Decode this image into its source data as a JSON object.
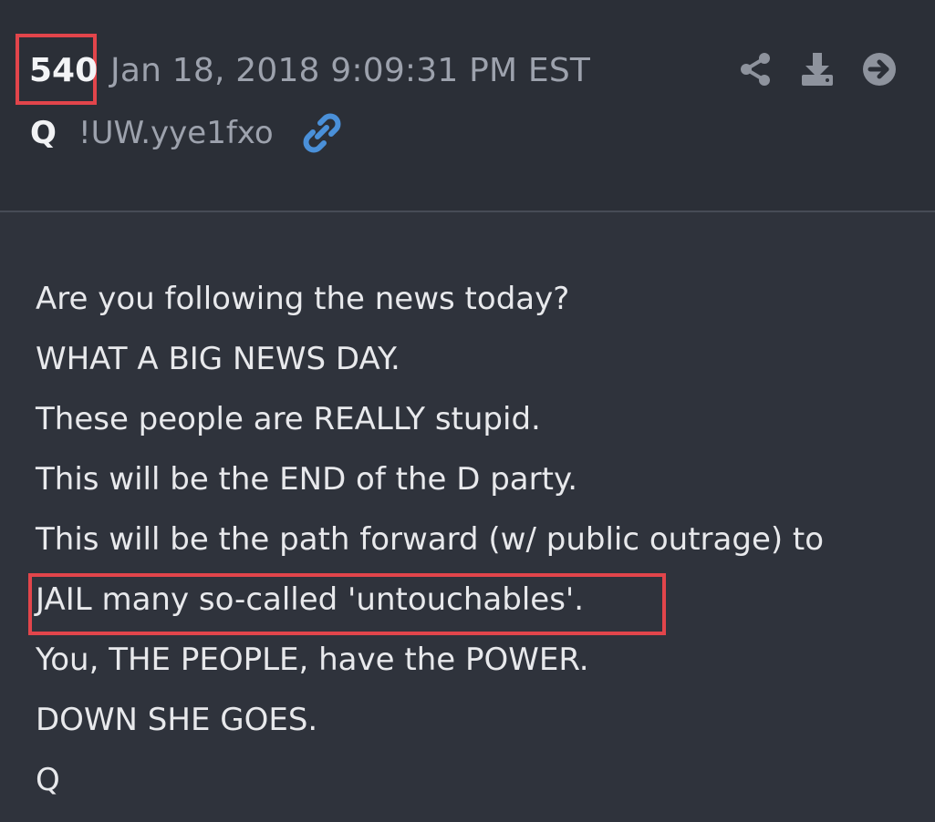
{
  "post": {
    "number": "540",
    "timestamp": "Jan 18, 2018 9:09:31 PM EST",
    "author": "Q",
    "tripcode": "!UW.yye1fxo",
    "lines": [
      "Are you following the news today?",
      "WHAT A BIG NEWS DAY.",
      "These people are REALLY stupid.",
      "This will be the END of the D party.",
      "This will be the path forward (w/ public outrage) to",
      "JAIL many so-called 'untouchables'.",
      "You, THE PEOPLE, have the POWER.",
      "DOWN SHE GOES.",
      "Q"
    ]
  },
  "icons": {
    "link": "link-icon",
    "share": "share-icon",
    "download": "download-icon",
    "forward": "arrow-right-icon"
  },
  "colors": {
    "background": "#2f333c",
    "header_background": "#2b2f37",
    "highlight": "#e2454b",
    "link_accent": "#4a90d9",
    "muted_text": "#9da2ad"
  }
}
